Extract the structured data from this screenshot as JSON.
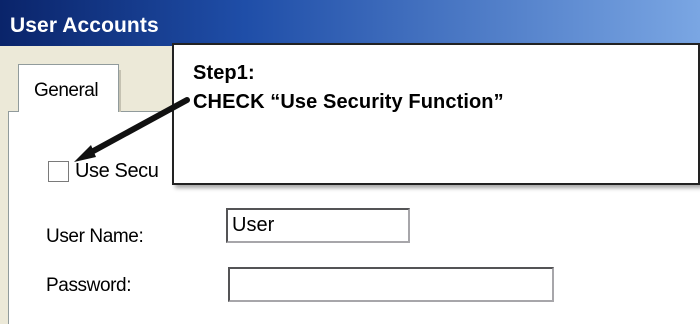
{
  "window": {
    "title": "User Accounts"
  },
  "tabs": [
    {
      "label": "General"
    }
  ],
  "form": {
    "security_checkbox_label": "Use Secu",
    "user_name_label": "User Name:",
    "user_name_value": "User",
    "password_label": "Password:",
    "password_value": ""
  },
  "callout": {
    "title": "Step1:",
    "body": "CHECK “Use Security Function”"
  },
  "icons": {
    "arrow": "arrow-icon"
  },
  "colors": {
    "titlebar_start": "#0a246a",
    "titlebar_end": "#7aa6e3",
    "window_bg": "#ece9d8"
  }
}
